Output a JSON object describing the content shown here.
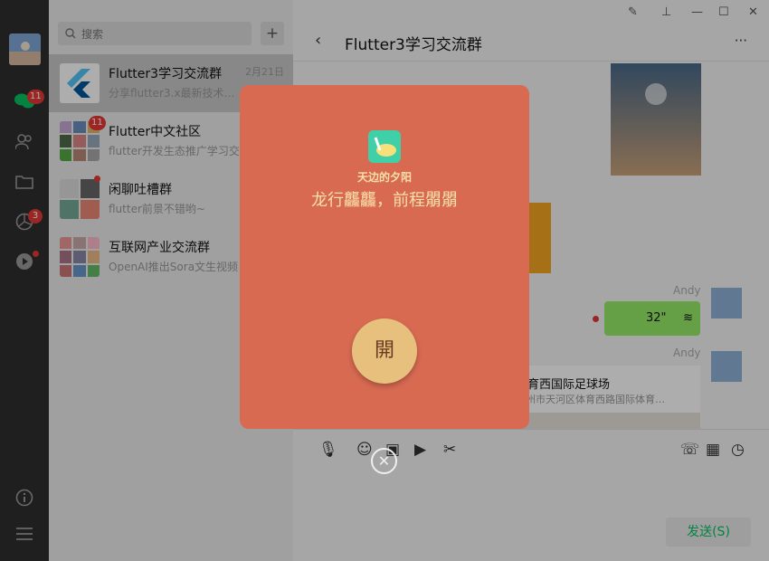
{
  "sidebar": {
    "badges": {
      "chat": "11",
      "moments": "3"
    }
  },
  "list": {
    "search_placeholder": "搜索",
    "add_label": "+",
    "items": [
      {
        "name": "Flutter3学习交流群",
        "message": "分享flutter3.x最新技术…",
        "time": "2月21日",
        "badge": ""
      },
      {
        "name": "Flutter中文社区",
        "message": "flutter开发生态推广学习交",
        "time": "",
        "badge": "11"
      },
      {
        "name": "闲聊吐槽群",
        "message": "flutter前景不错哟~",
        "time": "",
        "badge": ""
      },
      {
        "name": "互联网产业交流群",
        "message": "OpenAI推出Sora文生视频",
        "time": "",
        "badge": ""
      }
    ]
  },
  "chat": {
    "title": "Flutter3学习交流群",
    "back_icon": "‹",
    "more_icon": "···",
    "sender_name_1": "Andy",
    "sender_name_2": "Andy",
    "voice_duration": "32\"",
    "location_title": "体育西国际足球场",
    "location_address": "广州市天河区体育西路国际体育…",
    "send_label": "发送(S)"
  },
  "redpacket": {
    "sender": "天边的夕阳",
    "wish": "龙行龘龘，前程朤朤",
    "open_label": "開",
    "close_label": "✕"
  },
  "colors": {
    "packet": "#d86a52",
    "open_button": "#e7c07e",
    "accent": "#07c160"
  }
}
